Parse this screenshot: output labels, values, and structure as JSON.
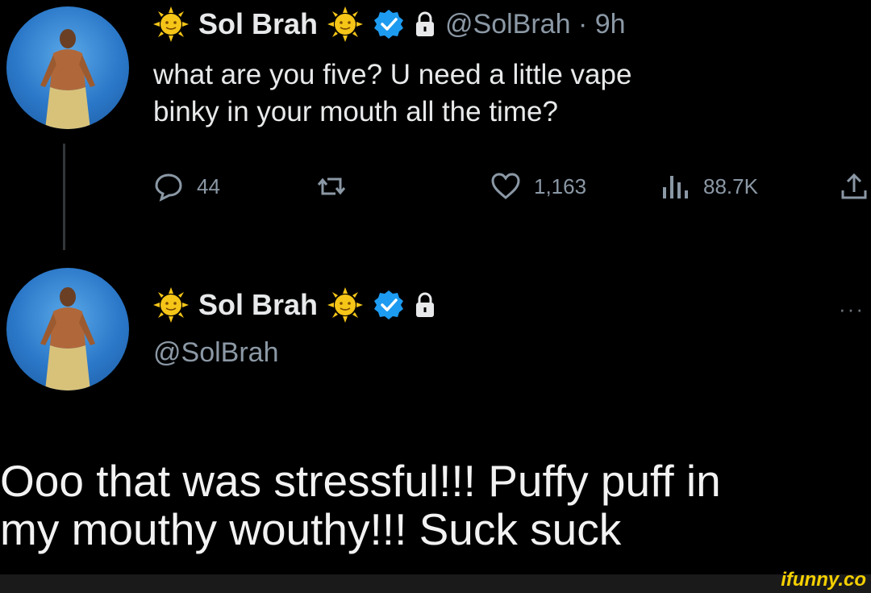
{
  "tweet_reply": {
    "author_name": "Sol Brah",
    "handle_time": "@SolBrah · 9h",
    "text_line1": "what are you five? U need a little vape",
    "text_line2": "binky in your mouth all the time?",
    "actions": {
      "replies": "44",
      "likes": "1,163",
      "views": "88.7K"
    }
  },
  "tweet_main": {
    "author_name": "Sol Brah",
    "handle": "@SolBrah",
    "more": "···",
    "text_line1": "Ooo that was stressful!!! Puffy puff in",
    "text_line2": "my mouthy wouthy!!! Suck suck"
  },
  "watermark": "ifunny.co",
  "colors": {
    "background": "#000000",
    "text": "#e7e9ea",
    "muted": "#8b98a5",
    "verified": "#1d9bf0",
    "sun": "#f5c518",
    "watermark": "#f5d000"
  },
  "icons": [
    "sun-emoji-icon",
    "verified-badge-icon",
    "lock-icon",
    "reply-icon",
    "retweet-icon",
    "like-icon",
    "views-icon",
    "share-icon"
  ]
}
